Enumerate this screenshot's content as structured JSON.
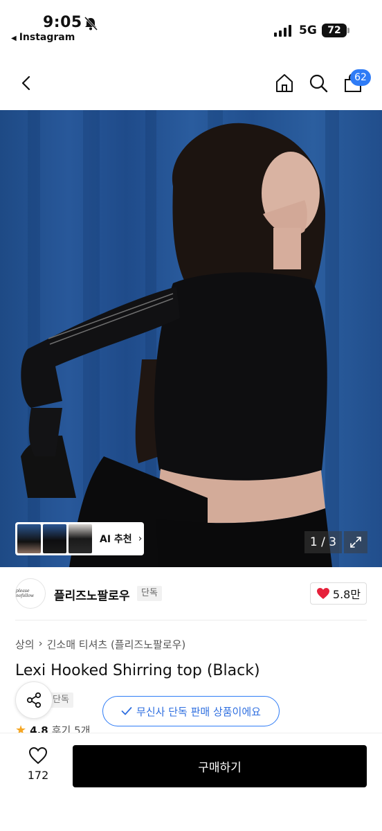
{
  "status_bar": {
    "time": "9:05",
    "back_app_label": "Instagram",
    "network": "5G",
    "battery": "72"
  },
  "nav": {
    "cart_count": "62"
  },
  "gallery": {
    "ai_label": "AI 추천",
    "page_indicator": "1 / 3"
  },
  "brand": {
    "name": "플리즈노팔로우",
    "exclusive_badge": "단독",
    "logo_text": "please nofollow",
    "likes": "5.8만"
  },
  "product": {
    "breadcrumb": [
      "상의",
      "긴소매 티셔츠 (플리즈노팔로우)"
    ],
    "title": "Lexi Hooked Shirring top (Black)",
    "badge": "단독",
    "rating": "4.8",
    "reviews": "후기 5개"
  },
  "notice": {
    "text": "무신사 단독 판매 상품이에요"
  },
  "bottom": {
    "wish_count": "172",
    "buy_label": "구매하기"
  },
  "colors": {
    "accent_blue": "#2f7cf6",
    "heart_red": "#e6213b",
    "buy_button": "#000000"
  }
}
